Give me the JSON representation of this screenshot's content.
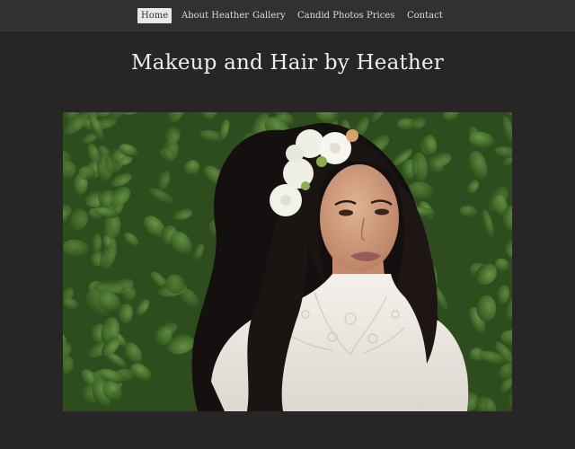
{
  "nav": {
    "items": [
      {
        "label": "Home",
        "active": true
      },
      {
        "label": "About Heather",
        "active": false
      },
      {
        "label": "Gallery",
        "active": false
      },
      {
        "label": "Candid Photos",
        "active": false
      },
      {
        "label": "Prices",
        "active": false
      },
      {
        "label": "Contact",
        "active": false
      }
    ]
  },
  "page": {
    "title": "Makeup and Hair by Heather"
  },
  "hero": {
    "subject": "portrait-photo"
  },
  "colors": {
    "background": "#272525",
    "navbar": "#323131",
    "active_tab": "#e8e8e8",
    "text": "#eeeeee"
  }
}
